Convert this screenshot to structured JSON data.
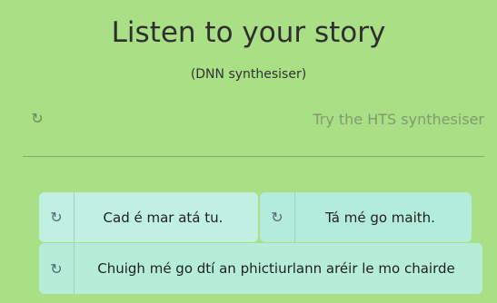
{
  "header": {
    "title": "Listen to your story",
    "subtitle": "(DNN synthesiser)"
  },
  "alt_synth": {
    "replay_icon": "↻",
    "link_label": "Try the HTS synthesiser"
  },
  "sentences": [
    {
      "icon": "↻",
      "text": "Cad é mar atá tu."
    },
    {
      "icon": "↻",
      "text": "Tá mé go maith."
    },
    {
      "icon": "↻",
      "text": "Chuigh mé go dtí an phictiurlann aréir le mo chairde"
    }
  ],
  "colors": {
    "background": "#a9df85",
    "chip": "#b3ecd9"
  }
}
